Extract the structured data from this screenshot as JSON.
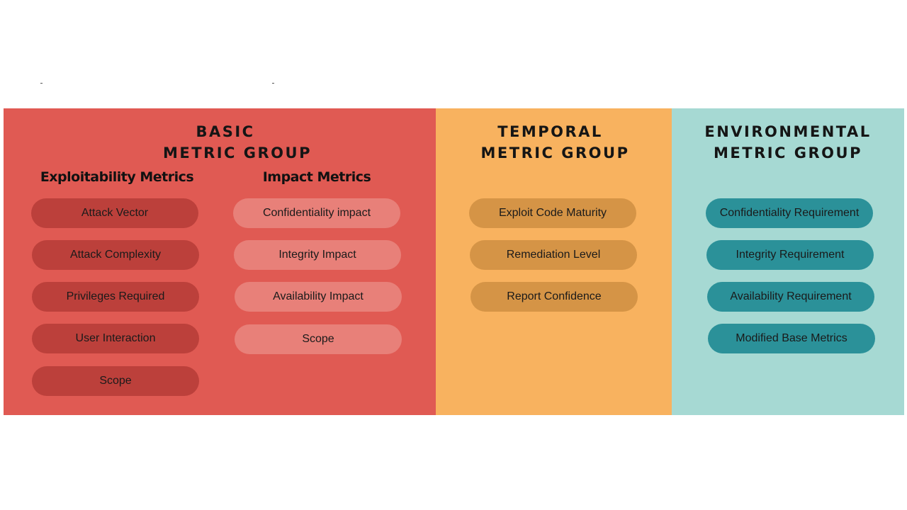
{
  "colors": {
    "basic_panel": "#e05a53",
    "temporal_panel": "#f8b25f",
    "environmental_panel": "#a6d9d3",
    "exploitability_pill": "#bc403b",
    "impact_pill": "#e88079",
    "temporal_pill": "#d59446",
    "environmental_pill": "#2b9199"
  },
  "basic": {
    "title_line1": "BASIC",
    "title_line2": "METRIC GROUP",
    "exploitability": {
      "heading": "Exploitability Metrics",
      "items": [
        "Attack Vector",
        "Attack Complexity",
        "Privileges Required",
        "User Interaction",
        "Scope"
      ]
    },
    "impact": {
      "heading": "Impact Metrics",
      "items": [
        "Confidentiality impact",
        "Integrity Impact",
        "Availability Impact",
        "Scope"
      ]
    }
  },
  "temporal": {
    "title_line1": "TEMPORAL",
    "title_line2": "METRIC GROUP",
    "items": [
      "Exploit Code Maturity",
      "Remediation Level",
      "Report Confidence"
    ]
  },
  "environmental": {
    "title_line1": "ENVIRONMENTAL",
    "title_line2": "METRIC GROUP",
    "items": [
      "Confidentiality Requirement",
      "Integrity Requirement",
      "Availability Requirement",
      "Modified Base Metrics"
    ]
  }
}
